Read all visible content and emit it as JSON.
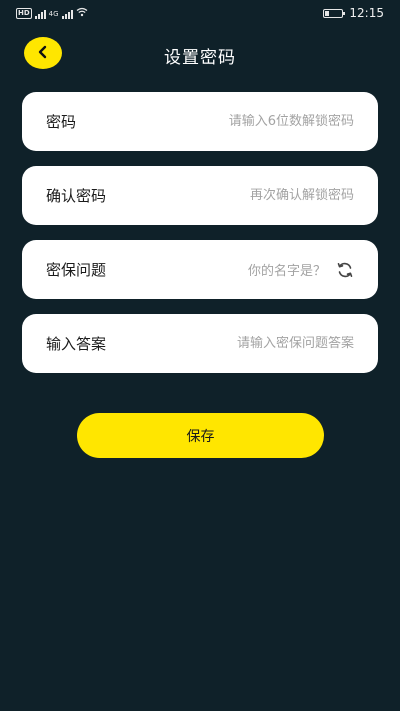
{
  "status_bar": {
    "hd_label": "HD",
    "network_label": "4G",
    "time": "12:15"
  },
  "header": {
    "title": "设置密码",
    "back_icon": "chevron-left-icon"
  },
  "form": {
    "password": {
      "label": "密码",
      "placeholder": "请输入6位数解锁密码"
    },
    "confirm": {
      "label": "确认密码",
      "placeholder": "再次确认解锁密码"
    },
    "question": {
      "label": "密保问题",
      "value": "你的名字是？",
      "icon": "refresh-icon"
    },
    "answer": {
      "label": "输入答案",
      "placeholder": "请输入密保问题答案"
    }
  },
  "actions": {
    "save_label": "保存"
  },
  "colors": {
    "background": "#0f2129",
    "accent": "#ffe600",
    "card": "#ffffff",
    "placeholder": "#a3a3a3"
  }
}
